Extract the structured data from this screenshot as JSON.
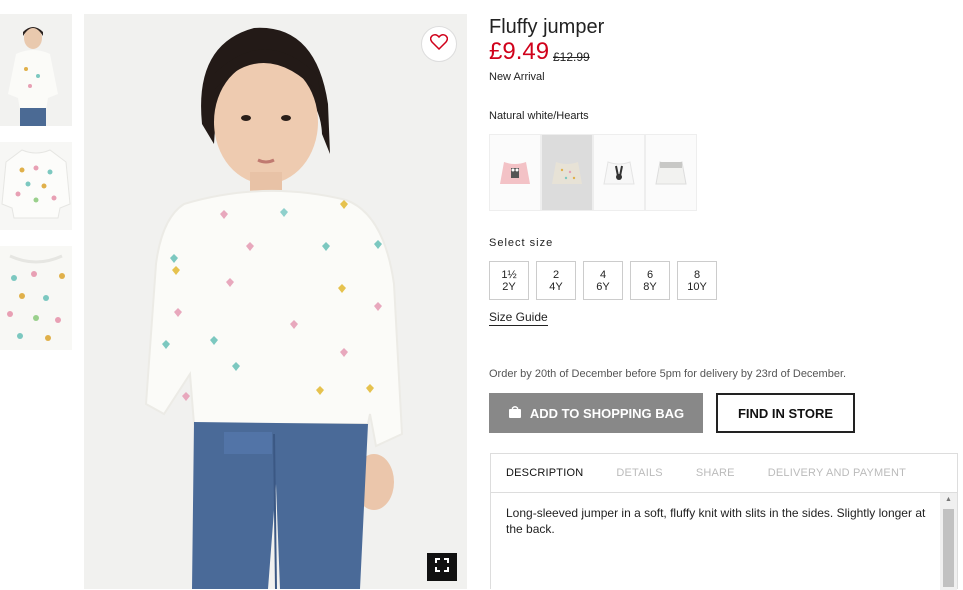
{
  "product": {
    "title": "Fluffy jumper",
    "price_now": "£9.49",
    "price_was": "£12.99",
    "badge": "New Arrival",
    "color_name": "Natural white/Hearts"
  },
  "swatches": [
    {
      "name": "pink-bulldog",
      "selected": false
    },
    {
      "name": "natural-white-hearts",
      "selected": true
    },
    {
      "name": "white-bunny",
      "selected": false
    },
    {
      "name": "white-grey-fluffy",
      "selected": false
    }
  ],
  "size_section": {
    "label": "Select size",
    "sizes": [
      {
        "top": "1½",
        "bottom": "2Y"
      },
      {
        "top": "2",
        "bottom": "4Y"
      },
      {
        "top": "4",
        "bottom": "6Y"
      },
      {
        "top": "6",
        "bottom": "8Y"
      },
      {
        "top": "8",
        "bottom": "10Y"
      }
    ],
    "guide": "Size Guide"
  },
  "delivery_note": "Order by 20th of December before 5pm for delivery by 23rd of December.",
  "actions": {
    "add_to_bag": "ADD TO SHOPPING BAG",
    "find_in_store": "FIND IN STORE"
  },
  "tabs": [
    {
      "label": "DESCRIPTION",
      "active": true
    },
    {
      "label": "DETAILS",
      "active": false
    },
    {
      "label": "SHARE",
      "active": false
    },
    {
      "label": "DELIVERY AND PAYMENT",
      "active": false
    }
  ],
  "description": "Long-sleeved jumper in a soft, fluffy knit with slits in the sides. Slightly longer at the back.",
  "colors": {
    "sale_price": "#d0021b",
    "add_bag_bg": "#888888",
    "selected_swatch": "#dcdcdc"
  },
  "icons": {
    "favorite": "heart-outline-icon",
    "zoom": "fullscreen-icon",
    "bag": "shopping-bag-icon"
  }
}
